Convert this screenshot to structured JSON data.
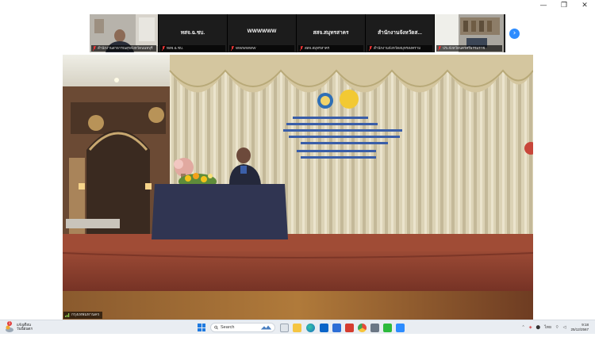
{
  "window": {
    "minimize_glyph": "—",
    "restore_glyph": "❐",
    "close_glyph": "✕"
  },
  "gallery": {
    "tiles": [
      {
        "name": "สำนักงานสาธารณสุขจังหวัดนนทบุรี",
        "has_video": true
      },
      {
        "name": "ทสจ.ฉ.ชบ.",
        "label": "ทสจ.ฉ.ชบ.",
        "has_video": false
      },
      {
        "name": "WWWWWW",
        "label": "WWWWWW",
        "has_video": false
      },
      {
        "name": "สสจ.สมุทรสาคร",
        "label": "สสจ.สมุทรสาคร",
        "has_video": false
      },
      {
        "name": "สำนักงานจังหวัดส...",
        "label": "สำนักงานจังหวัดสมุทรสงคราม",
        "has_video": false
      },
      {
        "name": "ประจังหวัดนครศรีธรรมราช",
        "has_video": true
      }
    ],
    "next_glyph": "›"
  },
  "main_video": {
    "label": "กรุงเทพมหานคร"
  },
  "taskbar": {
    "weather_temp": "แจ้งเตือน",
    "weather_desc": "วันนี้ฝนตก",
    "search_placeholder": "Search",
    "tray_lang": "ไทย",
    "clock_time": "9:18",
    "clock_date": "25/12/2567",
    "weather_badge": "1"
  },
  "colors": {
    "zoom_blue": "#2d8cff",
    "taskbar_bg": "#e9edf2",
    "stage_carpet": "#8a3e2e"
  }
}
